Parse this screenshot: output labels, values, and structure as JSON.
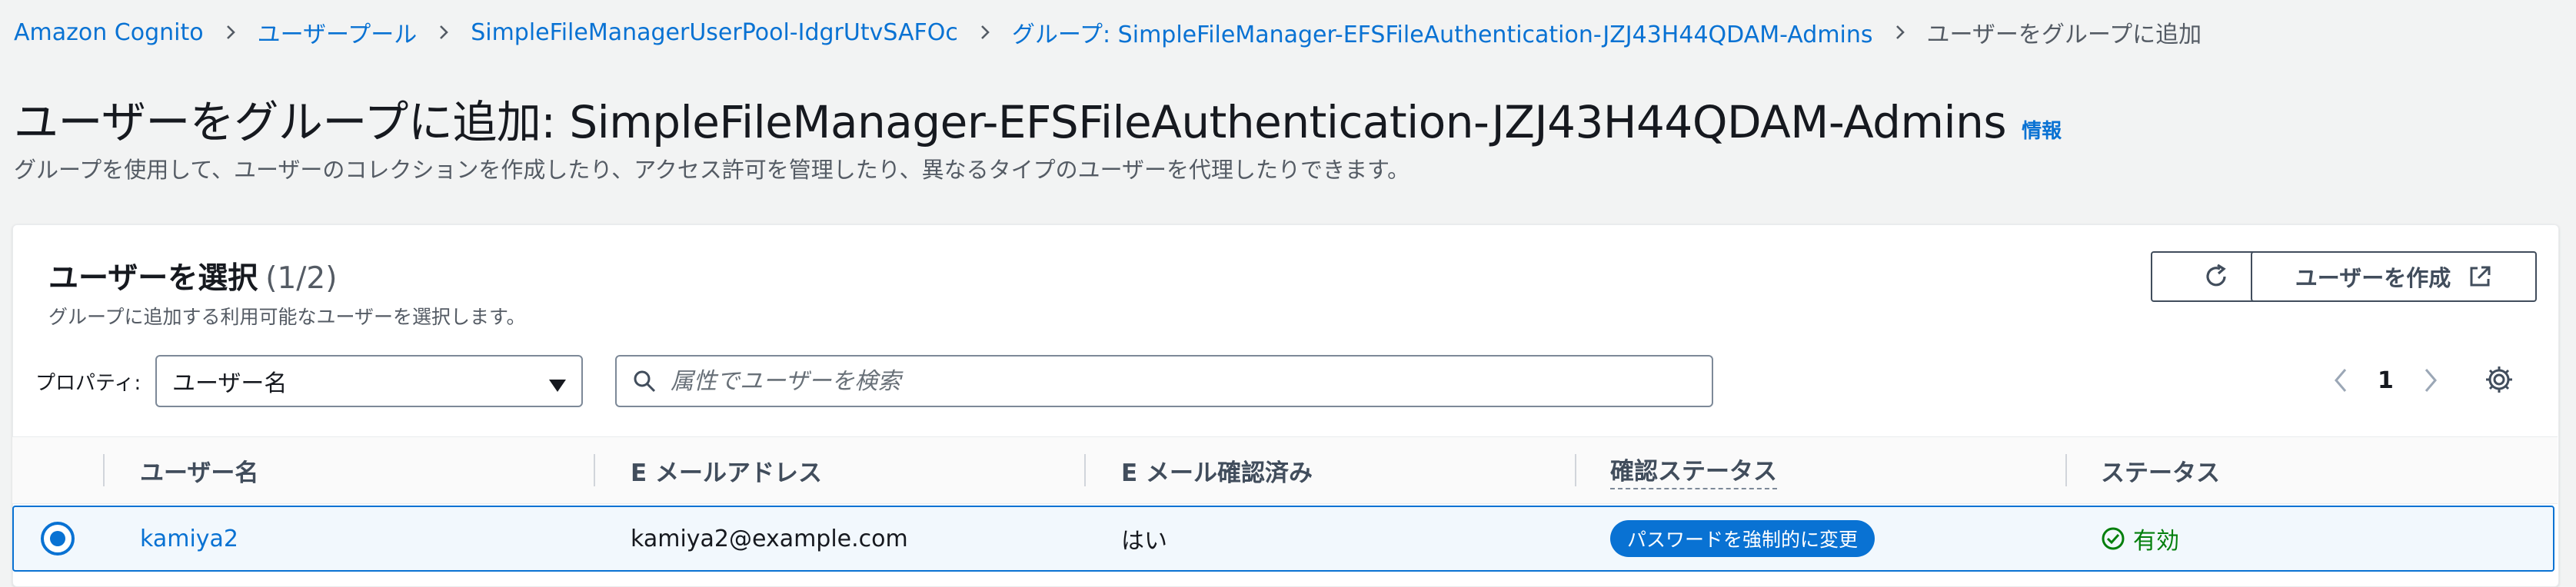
{
  "breadcrumb": {
    "items": [
      "Amazon Cognito",
      "ユーザープール",
      "SimpleFileManagerUserPool-IdgrUtvSAFOc",
      "グループ: SimpleFileManager-EFSFileAuthentication-JZJ43H44QDAM-Admins",
      "ユーザーをグループに追加"
    ]
  },
  "page": {
    "title": "ユーザーをグループに追加: SimpleFileManager-EFSFileAuthentication-JZJ43H44QDAM-Admins",
    "info_link": "情報",
    "description": "グループを使用して、ユーザーのコレクションを作成したり、アクセス許可を管理したり、異なるタイプのユーザーを代理したりできます。"
  },
  "panel": {
    "title": "ユーザーを選択",
    "count": "(1/2)",
    "description": "グループに追加する利用可能なユーザーを選択します。",
    "create_button": "ユーザーを作成"
  },
  "filter": {
    "property_label": "プロパティ:",
    "property_value": "ユーザー名",
    "search_placeholder": "属性でユーザーを検索"
  },
  "pagination": {
    "current_page": "1"
  },
  "table": {
    "columns": [
      "ユーザー名",
      "E メールアドレス",
      "E メール確認済み",
      "確認ステータス",
      "ステータス"
    ],
    "rows": [
      {
        "username": "kamiya2",
        "email": "kamiya2@example.com",
        "email_verified": "はい",
        "confirmation_status": "パスワードを強制的に変更",
        "status": "有効"
      }
    ]
  },
  "colors": {
    "link": "#0972d3",
    "status_enabled": "#037f0c",
    "badge_bg": "#0972d3"
  },
  "icons": [
    "chevron-right-icon",
    "refresh-icon",
    "external-link-icon",
    "caret-down-icon",
    "search-icon",
    "chevron-left-icon",
    "gear-icon",
    "radio-selected-icon",
    "check-circle-icon"
  ]
}
